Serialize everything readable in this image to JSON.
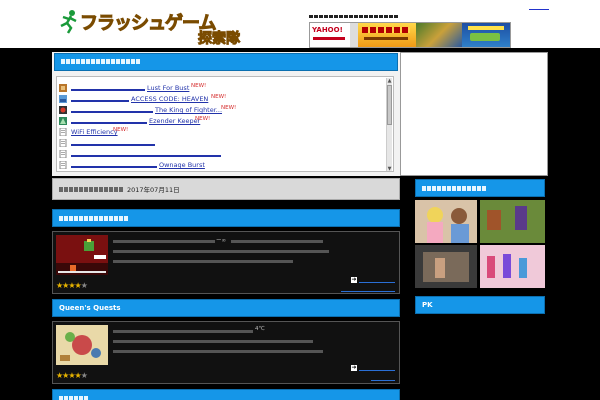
{
  "header": {
    "logo_text": "フラッシュゲーム",
    "logo_subtitle": "探索隊",
    "caption": "",
    "top_link": "",
    "banner_yahoo": "YAHOO!",
    "banner_promo": ""
  },
  "new_games": {
    "title": "",
    "items": [
      {
        "title": "Lust For Bust",
        "new_label": "NEW!"
      },
      {
        "title": "ACCESS CODE: HEAVEN",
        "new_label": "NEW!"
      },
      {
        "title": "The King of Fighter...",
        "new_label": "NEW!"
      },
      {
        "title": "Ezender Keeper",
        "new_label": "NEW!"
      },
      {
        "title": "WiFi Efficiency",
        "new_label": "NEW!"
      },
      {
        "title": "",
        "new_label": ""
      },
      {
        "title": "",
        "new_label": ""
      },
      {
        "title": "Ownage Burst",
        "new_label": ""
      }
    ]
  },
  "update": {
    "label": "",
    "date": "2017年07月11日"
  },
  "sections": {
    "featured_title": "",
    "queens_title": "Queen's Quests",
    "last_title": "",
    "right_title": "",
    "pk_title": "PK"
  },
  "cards": [
    {
      "name": "featured-game",
      "rating": 4,
      "rating_max": 5,
      "link_text": ""
    },
    {
      "name": "queens-quests",
      "rating": 4,
      "rating_max": 5,
      "link_text": ""
    }
  ],
  "colors": {
    "header_blue": "#1596e8",
    "star": "#e8b400",
    "new_red": "#d52b2b",
    "logo_orange": "#f7a21b"
  }
}
